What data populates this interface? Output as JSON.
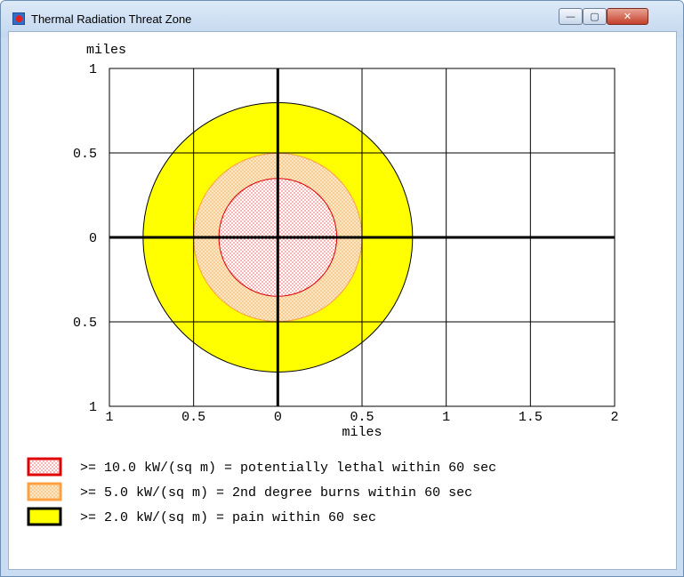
{
  "window": {
    "title": "Thermal Radiation Threat Zone",
    "buttons": {
      "minimize": "—",
      "maximize": "▢",
      "close": "✕"
    }
  },
  "chart_data": {
    "type": "area",
    "title": "",
    "xlabel": "miles",
    "ylabel": "miles",
    "xlim": [
      -1,
      2
    ],
    "ylim": [
      -1,
      1
    ],
    "x_ticks": [
      {
        "value": -1,
        "label": "1"
      },
      {
        "value": -0.5,
        "label": "0.5"
      },
      {
        "value": 0,
        "label": "0"
      },
      {
        "value": 0.5,
        "label": "0.5"
      },
      {
        "value": 1,
        "label": "1"
      },
      {
        "value": 1.5,
        "label": "1.5"
      },
      {
        "value": 2,
        "label": "2"
      }
    ],
    "y_ticks": [
      {
        "value": 1,
        "label": "1"
      },
      {
        "value": 0.5,
        "label": "0.5"
      },
      {
        "value": 0,
        "label": "0"
      },
      {
        "value": -0.5,
        "label": "0.5"
      },
      {
        "value": -1,
        "label": "1"
      }
    ],
    "grid": true,
    "center": [
      0,
      0
    ],
    "zones": [
      {
        "threshold": ">= 2.0 kW/(sq m) = pain within 60 sec",
        "radius_miles": 0.8,
        "fill": "#ffff00",
        "stroke": "#000000",
        "pattern": "solid"
      },
      {
        "threshold": ">= 5.0 kW/(sq m) = 2nd degree burns within 60 sec",
        "radius_miles": 0.5,
        "fill": "#f7d8a8",
        "stroke": "#ffa040",
        "pattern": "dots-orange"
      },
      {
        "threshold": ">= 10.0 kW/(sq m) = potentially lethal within 60 sec",
        "radius_miles": 0.35,
        "fill": "#ffffff",
        "stroke": "#e00000",
        "pattern": "dots-red"
      }
    ],
    "legend": {
      "placement": "bottom",
      "entries": [
        {
          "label": ">= 10.0 kW/(sq m) = potentially lethal within 60 sec",
          "fill": "#ffffff",
          "border": "#e00000",
          "pattern": "dots-red"
        },
        {
          "label": ">= 5.0 kW/(sq m) = 2nd degree burns within 60 sec",
          "fill": "#f7d8a8",
          "border": "#ffa040",
          "pattern": "dots-orange"
        },
        {
          "label": ">= 2.0 kW/(sq m) = pain within 60 sec",
          "fill": "#ffff00",
          "border": "#000000",
          "pattern": "solid"
        }
      ]
    }
  }
}
